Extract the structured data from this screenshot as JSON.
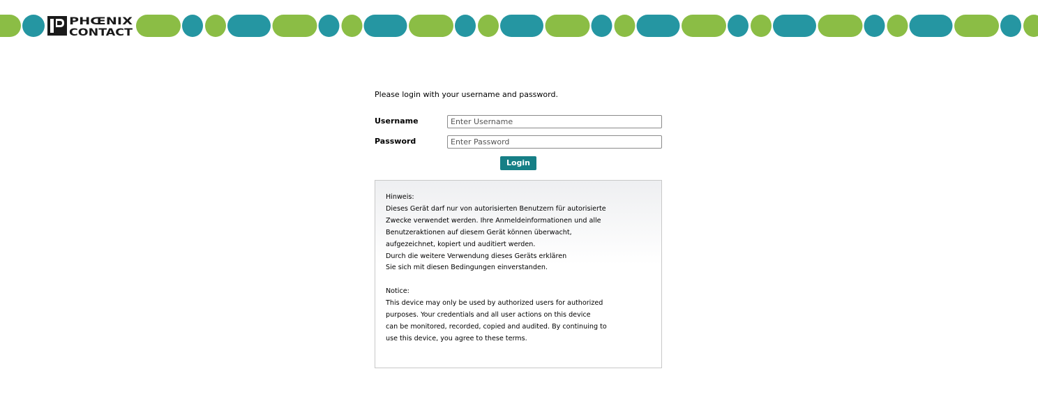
{
  "brand": {
    "logo_text": "PHOENIX CONTACT",
    "colors": {
      "teal": "#2596a2",
      "green": "#8bbd45",
      "button": "#167f86"
    }
  },
  "login": {
    "intro": "Please login with your username and password.",
    "username_label": "Username",
    "username_placeholder": "Enter Username",
    "password_label": "Password",
    "password_placeholder": "Enter Password",
    "login_button": "Login"
  },
  "notice": {
    "text": "Hinweis:\nDieses Gerät darf nur von autorisierten Benutzern für autorisierte\nZwecke verwendet werden. Ihre Anmeldeinformationen und alle\nBenutzeraktionen auf diesem Gerät können überwacht,\naufgezeichnet, kopiert und auditiert werden.\nDurch die weitere Verwendung dieses Geräts erklären\nSie sich mit diesen Bedingungen einverstanden.\n\nNotice:\nThis device may only be used by authorized users for authorized\npurposes. Your credentials and all user actions on this device\ncan be monitored, recorded, copied and audited. By continuing to\nuse this device, you agree to these terms."
  }
}
